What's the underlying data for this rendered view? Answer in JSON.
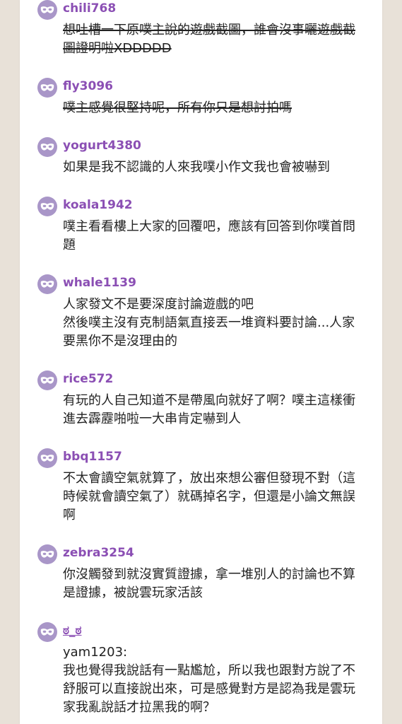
{
  "comments": [
    {
      "username": "chili768",
      "text": "想吐槽一下原噗主說的遊戲截圖，誰會沒事曬遊戲截圖證明啦XDDDDD",
      "strike": true
    },
    {
      "username": "fly3096",
      "text": "噗主感覺很堅持呢，所有你只是想討拍嗎",
      "strike": true
    },
    {
      "username": "yogurt4380",
      "text": "如果是我不認識的人來我噗小作文我也會被嚇到",
      "strike": false
    },
    {
      "username": "koala1942",
      "text": "噗主看看樓上大家的回覆吧，應該有回答到你噗首問題",
      "strike": false
    },
    {
      "username": "whale1139",
      "text": "人家發文不是要深度討論遊戲的吧\n然後噗主沒有克制語氣直接丟一堆資料要討論...人家要黑你不是沒理由的",
      "strike": false
    },
    {
      "username": "rice572",
      "text": "有玩的人自己知道不是帶風向就好了啊？噗主這樣衝進去霹靂啪啦一大串肯定嚇到人",
      "strike": false
    },
    {
      "username": "bbq1157",
      "text": "不太會讀空氣就算了，放出來想公審但發現不對（這時候就會讀空氣了）就碼掉名字，但還是小論文無誤啊",
      "strike": false
    },
    {
      "username": "zebra3254",
      "text": "你沒觸發到就沒實質證據，拿一堆別人的討論也不算是證據，被說雲玩家活該",
      "strike": false
    },
    {
      "username": "ಠ_ಠ",
      "text": "yam1203:\n我也覺得我說話有一點尷尬，所以我也跟對方說了不舒服可以直接說出來，可是感覺對方是認為我是雲玩家我亂說話才拉黑我的啊？",
      "strike": false
    }
  ],
  "colors": {
    "username": "#8b4fb4",
    "avatar_bg": "#a996c8",
    "page_bg": "#e8e1d8"
  },
  "icons": {
    "avatar": "anonymous-mask-icon"
  }
}
